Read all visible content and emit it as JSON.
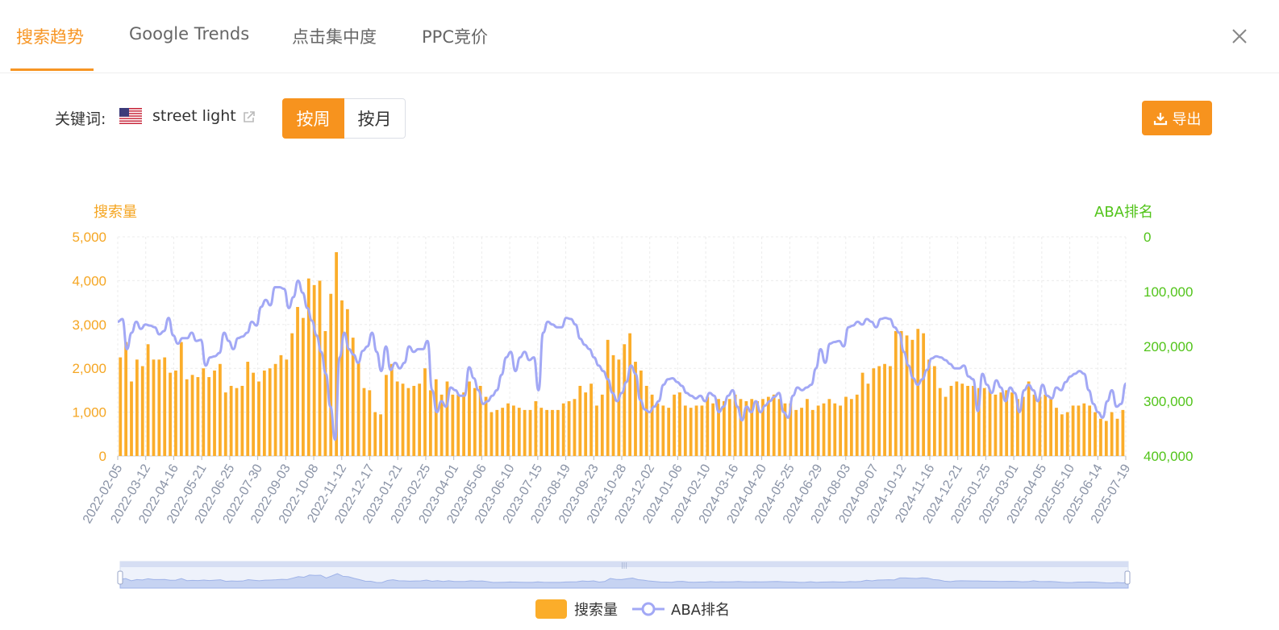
{
  "tabs": [
    {
      "label": "搜索趋势",
      "active": true
    },
    {
      "label": "Google Trends",
      "active": false
    },
    {
      "label": "点击集中度",
      "active": false
    },
    {
      "label": "PPC竞价",
      "active": false
    }
  ],
  "keyword": {
    "label": "关键词:",
    "value": "street light",
    "country_flag": "us-flag-icon"
  },
  "period_toggle": {
    "weekly": "按周",
    "monthly": "按月",
    "selected": "weekly"
  },
  "export_label": "导出",
  "colors": {
    "accent": "#f7931e",
    "bar": "#fbad2a",
    "line": "#a2a8f5",
    "left_axis": "#f5a623",
    "right_axis": "#52c41a"
  },
  "chart_data": {
    "type": "bar",
    "left_axis_name": "搜索量",
    "right_axis_name": "ABA排名",
    "ylim_left": [
      0,
      5000
    ],
    "ylim_right": [
      0,
      400000
    ],
    "right_axis_inverted": true,
    "yticks_left": [
      "0",
      "1,000",
      "2,000",
      "3,000",
      "4,000",
      "5,000"
    ],
    "yticks_right": [
      "400,000",
      "300,000",
      "200,000",
      "100,000",
      "0"
    ],
    "xticks": [
      "2022-02-05",
      "2022-03-12",
      "2022-04-16",
      "2022-05-21",
      "2022-06-25",
      "2022-07-30",
      "2022-09-03",
      "2022-10-08",
      "2022-11-12",
      "2022-12-17",
      "2023-01-21",
      "2023-02-25",
      "2023-04-01",
      "2023-05-06",
      "2023-06-10",
      "2023-07-15",
      "2023-08-19",
      "2023-09-23",
      "2023-10-28",
      "2023-12-02",
      "2024-01-06",
      "2024-02-10",
      "2024-03-16",
      "2024-04-20",
      "2024-05-25",
      "2024-06-29",
      "2024-08-03",
      "2024-09-07",
      "2024-10-12",
      "2024-11-16",
      "2024-12-21",
      "2025-01-25",
      "2025-03-01",
      "2025-04-05",
      "2025-05-10",
      "2025-06-14",
      "2025-07-19"
    ],
    "grid": true,
    "legend_position": "bottom-center",
    "series": [
      {
        "name": "搜索量",
        "type": "bar",
        "axis": "left",
        "values": [
          2250,
          2600,
          1700,
          2200,
          2050,
          2550,
          2200,
          2200,
          2250,
          1900,
          1950,
          2600,
          1750,
          1850,
          1800,
          2000,
          1800,
          1950,
          2100,
          1450,
          1600,
          1550,
          1600,
          2150,
          1900,
          1700,
          1950,
          2000,
          2100,
          2300,
          2200,
          2800,
          3400,
          3150,
          4050,
          3900,
          4000,
          2850,
          3700,
          4650,
          3550,
          3350,
          2700,
          2150,
          1550,
          1500,
          1000,
          950,
          1850,
          2100,
          1700,
          1650,
          1550,
          1600,
          1650,
          2000,
          1500,
          1750,
          1400,
          1700,
          1400,
          1400,
          1450,
          1700,
          1550,
          1600,
          1350,
          1000,
          1050,
          1100,
          1200,
          1150,
          1100,
          1050,
          1050,
          1250,
          1100,
          1050,
          1050,
          1050,
          1200,
          1250,
          1300,
          1600,
          1450,
          1650,
          1150,
          1400,
          2650,
          2300,
          2200,
          2550,
          2800,
          2150,
          1950,
          1600,
          1400,
          1200,
          1150,
          1100,
          1400,
          1450,
          1150,
          1100,
          1150,
          1150,
          1350,
          1200,
          1300,
          1250,
          1300,
          1400,
          1300,
          1250,
          1300,
          1250,
          1300,
          1350,
          1400,
          1300,
          1200,
          1200,
          1050,
          1100,
          1300,
          1050,
          1150,
          1200,
          1300,
          1200,
          1150,
          1350,
          1300,
          1400,
          1900,
          1650,
          2000,
          2050,
          2100,
          2050,
          2850,
          2850,
          2750,
          2650,
          2900,
          2800,
          2200,
          2050,
          1550,
          1350,
          1600,
          1700,
          1650,
          1600,
          1600,
          1550,
          1550,
          1500,
          1400,
          1450,
          1500,
          1450,
          1300,
          1350,
          1700,
          1400,
          1350,
          1400,
          1300,
          1100,
          950,
          1000,
          1150,
          1150,
          1200,
          1150,
          1000,
          850,
          800,
          1000,
          850,
          1050
        ]
      },
      {
        "name": "ABA排名",
        "type": "line",
        "axis": "right",
        "values": [
          155000,
          150000,
          205000,
          175000,
          155000,
          168000,
          160000,
          162000,
          165000,
          178000,
          172000,
          148000,
          180000,
          195000,
          185000,
          185000,
          175000,
          190000,
          188000,
          235000,
          220000,
          218000,
          212000,
          175000,
          190000,
          205000,
          185000,
          182000,
          175000,
          155000,
          162000,
          128000,
          115000,
          125000,
          92000,
          92000,
          95000,
          130000,
          110000,
          80000,
          102000,
          130000,
          153000,
          180000,
          210000,
          250000,
          310000,
          370000,
          220000,
          175000,
          205000,
          215000,
          230000,
          208000,
          200000,
          175000,
          210000,
          245000,
          200000,
          243000,
          230000,
          240000,
          230000,
          200000,
          210000,
          205000,
          205000,
          190000,
          280000,
          320000,
          300000,
          310000,
          275000,
          280000,
          290000,
          290000,
          238000,
          258000,
          280000,
          305000,
          300000,
          290000,
          280000,
          252000,
          220000,
          210000,
          245000,
          220000,
          210000,
          225000,
          220000,
          280000,
          175000,
          155000,
          160000,
          165000,
          165000,
          148000,
          150000,
          160000,
          186000,
          197000,
          205000,
          220000,
          235000,
          245000,
          260000,
          285000,
          300000,
          285000,
          265000,
          235000,
          250000,
          298000,
          315000,
          320000,
          310000,
          300000,
          270000,
          260000,
          258000,
          265000,
          272000,
          285000,
          290000,
          295000,
          290000,
          300000,
          285000,
          290000,
          320000,
          310000,
          290000,
          280000,
          310000,
          335000,
          310000,
          320000,
          300000,
          320000,
          308000,
          300000,
          292000,
          285000,
          320000,
          330000,
          290000,
          275000,
          280000,
          275000,
          270000,
          240000,
          205000,
          230000,
          195000,
          192000,
          190000,
          200000,
          165000,
          162000,
          155000,
          160000,
          150000,
          155000,
          165000,
          150000,
          148000,
          150000,
          165000,
          175000,
          210000,
          235000,
          258000,
          270000,
          260000,
          243000,
          222000,
          218000,
          220000,
          225000,
          232000,
          240000,
          240000,
          235000,
          255000,
          260000,
          318000,
          250000,
          270000,
          285000,
          262000,
          275000,
          300000,
          275000,
          285000,
          320000,
          280000,
          270000,
          280000,
          300000,
          270000,
          290000,
          295000,
          275000,
          280000,
          265000,
          255000,
          250000,
          245000,
          250000,
          280000,
          305000,
          320000,
          330000,
          300000,
          280000,
          310000,
          305000,
          268000
        ]
      }
    ]
  }
}
